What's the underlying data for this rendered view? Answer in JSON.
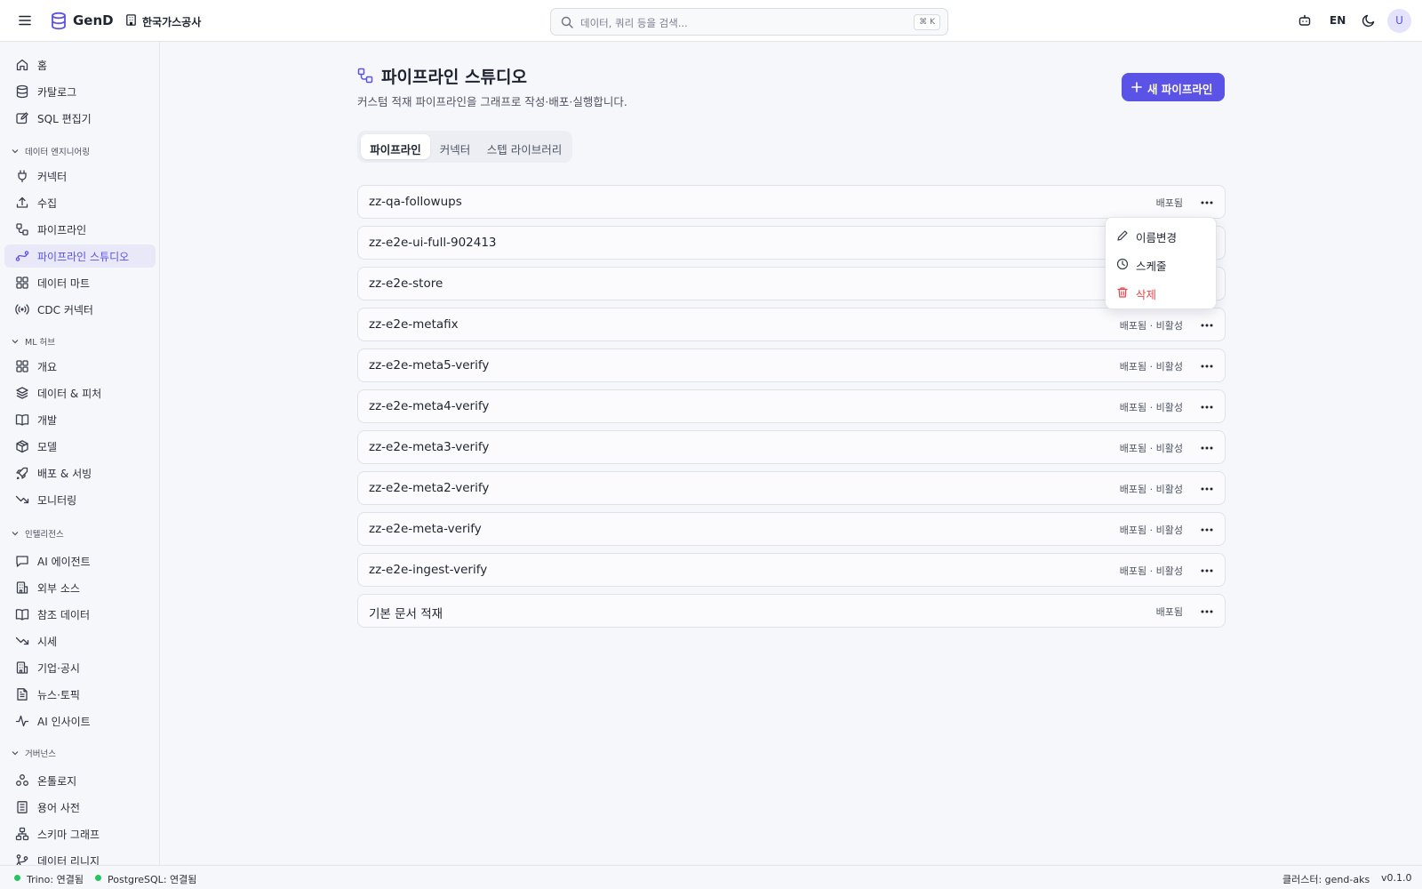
{
  "topbar": {
    "brand": "GenD",
    "org": "한국가스공사",
    "search_placeholder": "데이터, 쿼리 등을 검색...",
    "search_shortcut": "⌘ K",
    "language": "EN",
    "avatar_initial": "U"
  },
  "sidebar": {
    "items_top": [
      {
        "label": "홈",
        "icon": "home-icon"
      },
      {
        "label": "카탈로그",
        "icon": "database-icon"
      },
      {
        "label": "SQL 편집기",
        "icon": "edit-icon"
      }
    ],
    "sections": [
      {
        "label": "데이터 엔지니어링",
        "items": [
          {
            "label": "커넥터",
            "icon": "plug-icon"
          },
          {
            "label": "수집",
            "icon": "upload-icon"
          },
          {
            "label": "파이프라인",
            "icon": "workflow-icon"
          },
          {
            "label": "파이프라인 스튜디오",
            "icon": "spline-icon"
          },
          {
            "label": "데이터 마트",
            "icon": "grid-icon"
          },
          {
            "label": "CDC 커넥터",
            "icon": "radio-icon"
          }
        ]
      },
      {
        "label": "ML 허브",
        "items": [
          {
            "label": "개요",
            "icon": "grid-icon"
          },
          {
            "label": "데이터 & 피처",
            "icon": "layers-icon"
          },
          {
            "label": "개발",
            "icon": "book-icon"
          },
          {
            "label": "모델",
            "icon": "box-icon"
          },
          {
            "label": "배포 & 서빙",
            "icon": "rocket-icon"
          },
          {
            "label": "모니터링",
            "icon": "trend-down-icon"
          }
        ]
      },
      {
        "label": "인텔리전스",
        "items": [
          {
            "label": "AI 에이전트",
            "icon": "message-icon"
          },
          {
            "label": "외부 소스",
            "icon": "building-icon"
          },
          {
            "label": "참조 데이터",
            "icon": "book-icon"
          },
          {
            "label": "시세",
            "icon": "trend-down-icon"
          },
          {
            "label": "기업·공시",
            "icon": "building-icon"
          },
          {
            "label": "뉴스·토픽",
            "icon": "file-text-icon"
          },
          {
            "label": "AI 인사이트",
            "icon": "activity-icon"
          }
        ]
      },
      {
        "label": "거버넌스",
        "items": [
          {
            "label": "온톨로지",
            "icon": "nodes-icon"
          },
          {
            "label": "용어 사전",
            "icon": "book-list-icon"
          },
          {
            "label": "스키마 그래프",
            "icon": "network-icon"
          },
          {
            "label": "데이터 리니지",
            "icon": "git-branch-icon"
          }
        ]
      }
    ],
    "active": "파이프라인 스튜디오"
  },
  "main": {
    "title": "파이프라인 스튜디오",
    "subtitle": "커스텀 적재 파이프라인을 그래프로 작성·배포·실행합니다.",
    "new_button": "새 파이프라인",
    "tabs": [
      {
        "label": "파이프라인",
        "active": true
      },
      {
        "label": "커넥터",
        "active": false
      },
      {
        "label": "스텝 라이브러리",
        "active": false
      }
    ],
    "pipelines": [
      {
        "name": "zz-qa-followups",
        "status": "배포됨"
      },
      {
        "name": "zz-e2e-ui-full-902413",
        "status": ""
      },
      {
        "name": "zz-e2e-store",
        "status": ""
      },
      {
        "name": "zz-e2e-metafix",
        "status": "배포됨 · 비활성"
      },
      {
        "name": "zz-e2e-meta5-verify",
        "status": "배포됨 · 비활성"
      },
      {
        "name": "zz-e2e-meta4-verify",
        "status": "배포됨 · 비활성"
      },
      {
        "name": "zz-e2e-meta3-verify",
        "status": "배포됨 · 비활성"
      },
      {
        "name": "zz-e2e-meta2-verify",
        "status": "배포됨 · 비활성"
      },
      {
        "name": "zz-e2e-meta-verify",
        "status": "배포됨 · 비활성"
      },
      {
        "name": "zz-e2e-ingest-verify",
        "status": "배포됨 · 비활성"
      },
      {
        "name": "기본 문서 적재",
        "status": "배포됨"
      }
    ],
    "menu": {
      "rename": "이름변경",
      "schedule": "스케줄",
      "delete": "삭제"
    }
  },
  "statusbar": {
    "trino": "Trino: 연결됨",
    "postgres": "PostgreSQL: 연결됨",
    "cluster": "클러스터: gend-aks",
    "version": "v0.1.0"
  },
  "colors": {
    "accent": "#5b52e6",
    "danger": "#e5484d",
    "connected": "#22c55e"
  }
}
